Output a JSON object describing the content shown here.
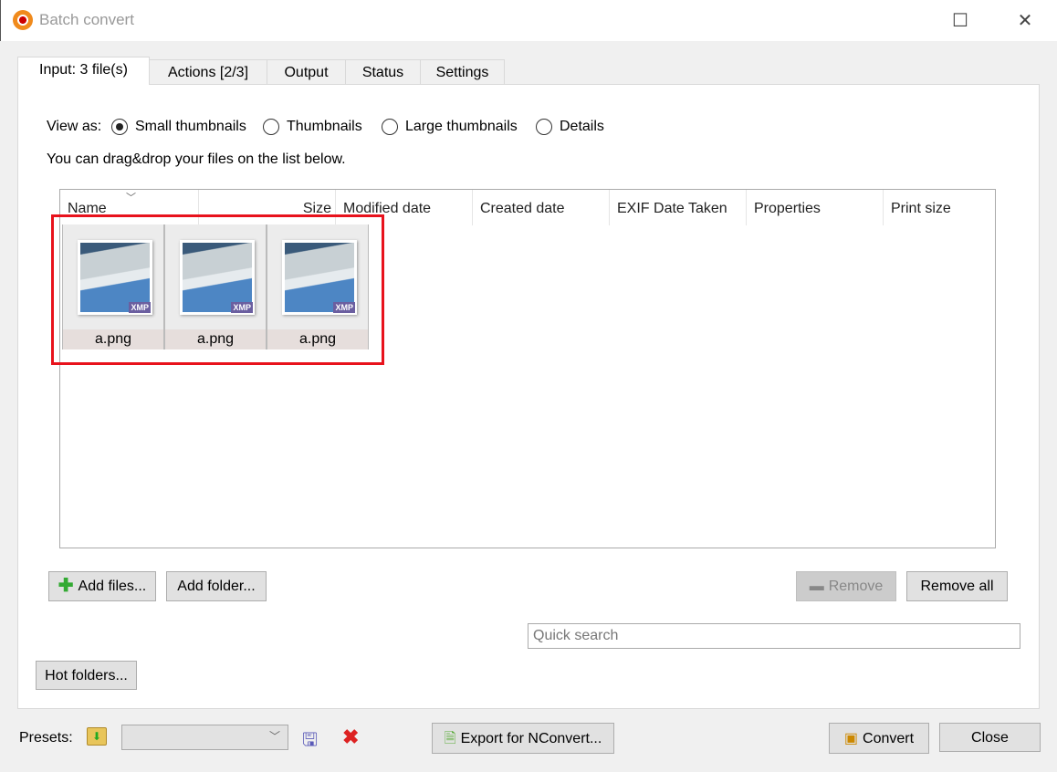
{
  "window": {
    "title": "Batch convert"
  },
  "tabs": [
    {
      "label": "Input: 3 file(s)"
    },
    {
      "label": "Actions [2/3]"
    },
    {
      "label": "Output"
    },
    {
      "label": "Status"
    },
    {
      "label": "Settings"
    }
  ],
  "view": {
    "label": "View as:",
    "options": [
      "Small thumbnails",
      "Thumbnails",
      "Large thumbnails",
      "Details"
    ],
    "selected": "Small thumbnails"
  },
  "hint": "You can drag&drop your files on the list below.",
  "columns": [
    "Name",
    "Size",
    "Modified date",
    "Created date",
    "EXIF Date Taken",
    "Properties",
    "Print size"
  ],
  "files": [
    {
      "name": "a.png",
      "badge": "XMP"
    },
    {
      "name": "a.png",
      "badge": "XMP"
    },
    {
      "name": "a.png",
      "badge": "XMP"
    }
  ],
  "buttons": {
    "add_files": "Add files...",
    "add_folder": "Add folder...",
    "remove": "Remove",
    "remove_all": "Remove all",
    "hot_folders": "Hot folders...",
    "export": "Export for NConvert...",
    "convert": "Convert",
    "close": "Close"
  },
  "search": {
    "placeholder": "Quick search",
    "value": ""
  },
  "presets": {
    "label": "Presets:",
    "value": ""
  }
}
